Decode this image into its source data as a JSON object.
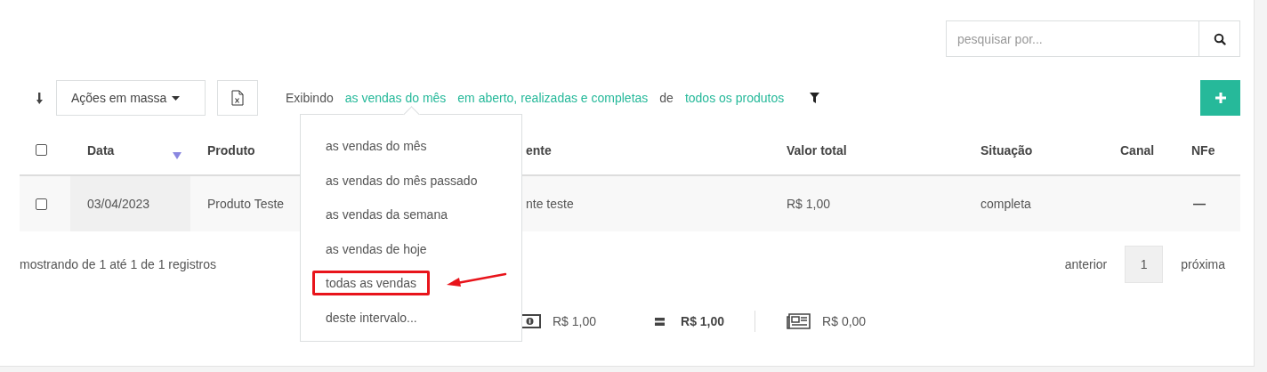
{
  "search": {
    "placeholder": "pesquisar por..."
  },
  "toolbar": {
    "bulk_actions": "Ações em massa",
    "filter_text": [
      {
        "kind": "text",
        "text": "Exibindo"
      },
      {
        "kind": "link",
        "text": "as vendas do mês"
      },
      {
        "kind": "link",
        "text": "em aberto, realizadas e completas"
      },
      {
        "kind": "text",
        "text": "de"
      },
      {
        "kind": "link",
        "text": "todos os produtos"
      }
    ]
  },
  "table": {
    "select_all": {
      "checked": false
    },
    "columns": [
      {
        "label": "Data",
        "sorted": true
      },
      {
        "label": "Produto",
        "sorted": false
      },
      {
        "label": "ente",
        "sorted": false
      },
      {
        "label": "Valor total",
        "sorted": false
      },
      {
        "label": "Situação",
        "sorted": false
      },
      {
        "label": "Canal",
        "sorted": false
      },
      {
        "label": "NFe",
        "sorted": false
      }
    ],
    "rows": [
      {
        "checked": false,
        "cells": [
          "03/04/2023",
          "Produto Teste",
          "nte teste",
          "R$ 1,00",
          "completa",
          "",
          "—"
        ]
      }
    ]
  },
  "footer": {
    "info": "mostrando de 1 até 1 de 1 registros",
    "previous": "anterior",
    "pages": [
      {
        "label": "1",
        "selected": true
      }
    ],
    "next": "próxima"
  },
  "totals": [
    {
      "kind": "money",
      "text": "R$ 1,00"
    },
    {
      "kind": "equals",
      "text": "R$ 1,00"
    },
    {
      "kind": "invoice",
      "text": "R$ 0,00"
    }
  ],
  "dropdown": {
    "items": [
      {
        "label": "as vendas do mês",
        "annotated": false
      },
      {
        "label": "as vendas do mês passado",
        "annotated": false
      },
      {
        "label": "as vendas da semana",
        "annotated": false
      },
      {
        "label": "as vendas de hoje",
        "annotated": false
      },
      {
        "label": "todas as vendas",
        "annotated": true
      },
      {
        "label": "deste intervalo...",
        "annotated": false
      }
    ]
  }
}
